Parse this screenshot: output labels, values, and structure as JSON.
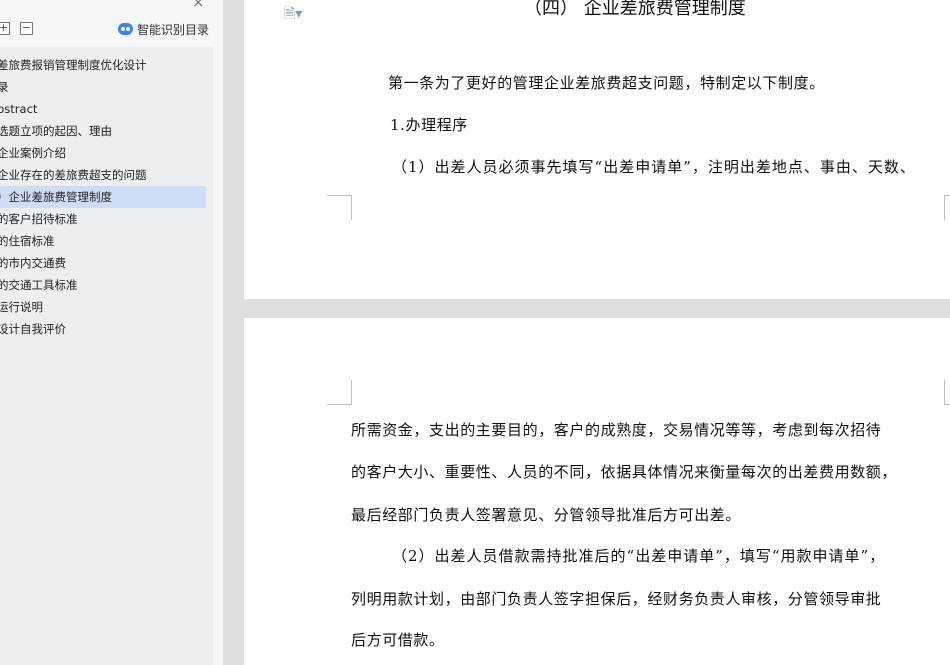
{
  "sidebar": {
    "close_icon": "×",
    "expand_icon": "+",
    "collapse_icon": "−",
    "smart_toc_label": "智能识别目录",
    "toc_items": [
      "差旅费报销管理制度优化设计",
      "录",
      "bstract",
      "选题立项的起因、理由",
      "企业案例介绍",
      "企业存在的差旅费超支的问题",
      "）企业差旅费管理制度",
      "的客户招待标准",
      "的住宿标准",
      "的市内交通费",
      "的交通工具标准",
      "运行说明",
      "设计自我评价"
    ],
    "active_index": 6
  },
  "document": {
    "heading": "（四） 企业差旅费管理制度",
    "page1": [
      "第一条为了更好的管理企业差旅费超支问题，特制定以下制度。",
      "1.办理程序",
      "（1）出差人员必须事先填写“出差申请单”，注明出差地点、事由、天数、"
    ],
    "page2": [
      "所需资金，支出的主要目的，客户的成熟度，交易情况等等，考虑到每次招待",
      "的客户大小、重要性、人员的不同，依据具体情况来衡量每次的出差费用数额，",
      "最后经部门负责人签署意见、分管领导批准后方可出差。",
      "（2）出差人员借款需持批准后的“出差申请单”，填写“用款申请单”，",
      "列明用款计划，由部门负责人签字担保后，经财务负责人审核，分管领导审批",
      "后方可借款。"
    ]
  }
}
